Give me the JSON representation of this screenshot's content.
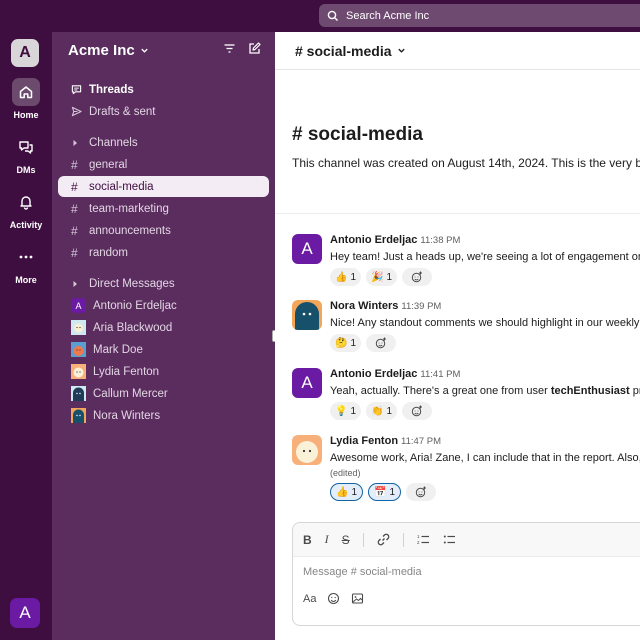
{
  "search": {
    "placeholder": "Search Acme Inc"
  },
  "workspace": {
    "initial": "A",
    "name": "Acme Inc"
  },
  "rail": {
    "items": [
      {
        "label": "Home",
        "icon": "home-icon"
      },
      {
        "label": "DMs",
        "icon": "dms-icon"
      },
      {
        "label": "Activity",
        "icon": "bell-icon"
      },
      {
        "label": "More",
        "icon": "more-icon"
      }
    ],
    "user_initial": "A"
  },
  "sidebar": {
    "threads": "Threads",
    "drafts": "Drafts & sent",
    "channels_header": "Channels",
    "channels": [
      "general",
      "social-media",
      "team-marketing",
      "announcements",
      "random"
    ],
    "active_channel": "social-media",
    "dm_header": "Direct Messages",
    "dms": [
      "Antonio Erdeljac",
      "Aria Blackwood",
      "Mark Doe",
      "Lydia Fenton",
      "Callum Mercer",
      "Nora Winters"
    ]
  },
  "channel": {
    "header": "# social-media",
    "intro_title": "# social-media",
    "intro_text": "This channel was created on August 14th, 2024. This is the very b"
  },
  "messages": [
    {
      "author": "Antonio Erdeljac",
      "time": "11:38 PM",
      "text": "Hey team! Just a heads up, we're seeing a lot of engagement on",
      "reactions": [
        {
          "emoji": "👍",
          "count": "1"
        },
        {
          "emoji": "🎉",
          "count": "1"
        }
      ]
    },
    {
      "author": "Nora Winters",
      "time": "11:39 PM",
      "text": "Nice! Any standout comments we should highlight in our weekly",
      "reactions": [
        {
          "emoji": "🤔",
          "count": "1"
        }
      ]
    },
    {
      "author": "Antonio Erdeljac",
      "time": "11:41 PM",
      "text_before": "Yeah, actually. There's a great one from user ",
      "text_bold": "techEnthusiast",
      "text_after": " pr",
      "reactions": [
        {
          "emoji": "💡",
          "count": "1"
        },
        {
          "emoji": "👏",
          "count": "1"
        }
      ]
    },
    {
      "author": "Lydia Fenton",
      "time": "11:47 PM",
      "text": "Awesome work, Aria! Zane, I can include that in the report. Also,",
      "edited": "(edited)",
      "reactions": [
        {
          "emoji": "👍",
          "count": "1"
        },
        {
          "emoji": "📅",
          "count": "1"
        }
      ]
    }
  ],
  "composer": {
    "placeholder": "Message # social-media",
    "aa": "Aa"
  },
  "colors": {
    "aubergine": "#3f0e40",
    "sidebar": "#5a2d5e",
    "purple_avatar": "#6b1aa4",
    "link_blue": "#1264a3"
  }
}
